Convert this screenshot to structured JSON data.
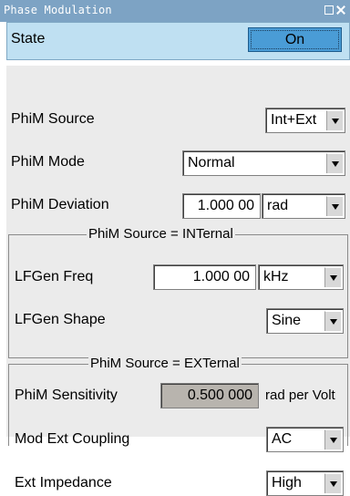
{
  "window": {
    "title": "Phase Modulation"
  },
  "state": {
    "label": "State",
    "value": "On"
  },
  "phim_source": {
    "label": "PhiM Source",
    "value": "Int+Ext"
  },
  "phim_mode": {
    "label": "PhiM Mode",
    "value": "Normal"
  },
  "phim_deviation": {
    "label": "PhiM Deviation",
    "value": "1.000 00",
    "unit": "rad"
  },
  "internal_group": {
    "title": "PhiM Source = INTernal",
    "lfgen_freq": {
      "label": "LFGen Freq",
      "value": "1.000 00",
      "unit": "kHz"
    },
    "lfgen_shape": {
      "label": "LFGen Shape",
      "value": "Sine"
    }
  },
  "external_group": {
    "title": "PhiM Source = EXTernal",
    "sensitivity": {
      "label": "PhiM Sensitivity",
      "value": "0.500 000",
      "unit": "rad per Volt"
    },
    "coupling": {
      "label": "Mod Ext Coupling",
      "value": "AC"
    },
    "impedance": {
      "label": "Ext Impedance",
      "value": "High"
    }
  }
}
